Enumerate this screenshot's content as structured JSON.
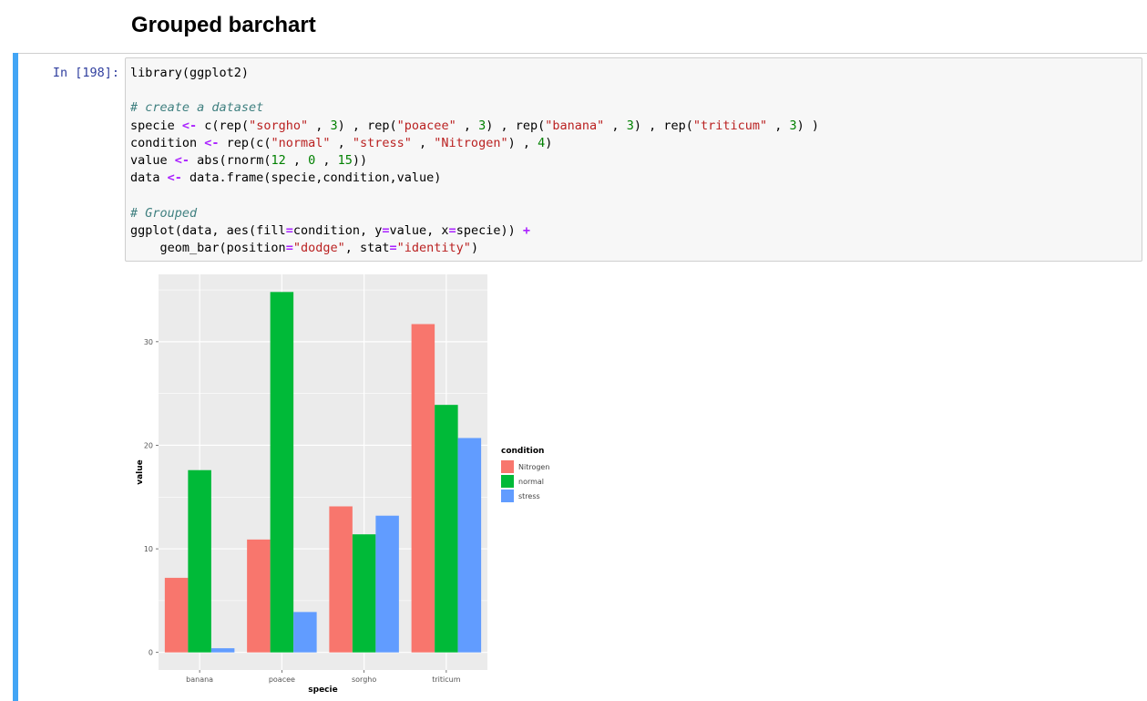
{
  "heading": "Grouped barchart",
  "cell": {
    "prompt": "In [198]:",
    "code_lines": [
      [
        {
          "t": "library(ggplot2)"
        }
      ],
      [],
      [
        {
          "t": "# create a dataset",
          "c": "comment"
        }
      ],
      [
        {
          "t": "specie "
        },
        {
          "t": "<-",
          "c": "op"
        },
        {
          "t": " c(rep("
        },
        {
          "t": "\"sorgho\"",
          "c": "str"
        },
        {
          "t": " , "
        },
        {
          "t": "3",
          "c": "num"
        },
        {
          "t": ") , rep("
        },
        {
          "t": "\"poacee\"",
          "c": "str"
        },
        {
          "t": " , "
        },
        {
          "t": "3",
          "c": "num"
        },
        {
          "t": ") , rep("
        },
        {
          "t": "\"banana\"",
          "c": "str"
        },
        {
          "t": " , "
        },
        {
          "t": "3",
          "c": "num"
        },
        {
          "t": ") , rep("
        },
        {
          "t": "\"triticum\"",
          "c": "str"
        },
        {
          "t": " , "
        },
        {
          "t": "3",
          "c": "num"
        },
        {
          "t": ") )"
        }
      ],
      [
        {
          "t": "condition "
        },
        {
          "t": "<-",
          "c": "op"
        },
        {
          "t": " rep(c("
        },
        {
          "t": "\"normal\"",
          "c": "str"
        },
        {
          "t": " , "
        },
        {
          "t": "\"stress\"",
          "c": "str"
        },
        {
          "t": " , "
        },
        {
          "t": "\"Nitrogen\"",
          "c": "str"
        },
        {
          "t": ") , "
        },
        {
          "t": "4",
          "c": "num"
        },
        {
          "t": ")"
        }
      ],
      [
        {
          "t": "value "
        },
        {
          "t": "<-",
          "c": "op"
        },
        {
          "t": " abs(rnorm("
        },
        {
          "t": "12",
          "c": "num"
        },
        {
          "t": " , "
        },
        {
          "t": "0",
          "c": "num"
        },
        {
          "t": " , "
        },
        {
          "t": "15",
          "c": "num"
        },
        {
          "t": "))"
        }
      ],
      [
        {
          "t": "data "
        },
        {
          "t": "<-",
          "c": "op"
        },
        {
          "t": " data.frame(specie,condition,value)"
        }
      ],
      [],
      [
        {
          "t": "# Grouped",
          "c": "comment"
        }
      ],
      [
        {
          "t": "ggplot(data, aes(fill"
        },
        {
          "t": "=",
          "c": "op"
        },
        {
          "t": "condition, y"
        },
        {
          "t": "=",
          "c": "op"
        },
        {
          "t": "value, x"
        },
        {
          "t": "=",
          "c": "op"
        },
        {
          "t": "specie)) "
        },
        {
          "t": "+",
          "c": "op"
        }
      ],
      [
        {
          "t": "    geom_bar(position"
        },
        {
          "t": "=",
          "c": "op"
        },
        {
          "t": "\"dodge\"",
          "c": "str"
        },
        {
          "t": ", stat"
        },
        {
          "t": "=",
          "c": "op"
        },
        {
          "t": "\"identity\"",
          "c": "str"
        },
        {
          "t": ")"
        }
      ]
    ]
  },
  "colors": {
    "selection_bar": "#42a5f5",
    "panel_bg": "#ebebeb",
    "grid": "#ffffff"
  },
  "chart_data": {
    "type": "bar",
    "categories": [
      "banana",
      "poacee",
      "sorgho",
      "triticum"
    ],
    "series": [
      {
        "name": "Nitrogen",
        "color": "#f8766d",
        "values": [
          7.2,
          10.9,
          14.1,
          31.7
        ]
      },
      {
        "name": "normal",
        "color": "#00ba38",
        "values": [
          17.6,
          34.8,
          11.4,
          23.9
        ]
      },
      {
        "name": "stress",
        "color": "#619cff",
        "values": [
          0.4,
          3.9,
          13.2,
          20.7
        ]
      }
    ],
    "xlabel": "specie",
    "ylabel": "value",
    "ylim": [
      -1.7,
      36.5
    ],
    "yticks": [
      0,
      10,
      20,
      30
    ],
    "ytick_labels": [
      "0",
      "10",
      "20",
      "30"
    ],
    "legend_title": "condition",
    "legend_position": "right",
    "grid": true
  }
}
